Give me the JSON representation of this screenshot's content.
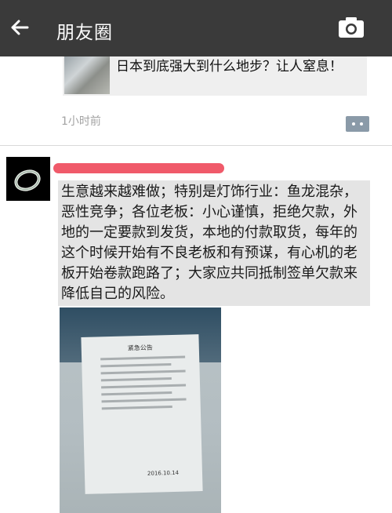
{
  "header": {
    "title": "朋友圈",
    "back_icon": "arrow-left-icon",
    "camera_icon": "camera-icon",
    "background": "#3a3a3a"
  },
  "previous_post": {
    "share_title": "日本到底强大到什么地步？让人窒息！",
    "time": "1小时前",
    "comment_icon": "comment-bubble-icon"
  },
  "post": {
    "author": "",
    "content": "生意越来越难做；特别是灯饰行业：鱼龙混杂，恶性竞争；各位老板：小心谨慎，拒绝欠款，外地的一定要款到发货，本地的付款取货，每年的这个时候开始有不良老板和有预谋，有心机的老板开始卷款跑路了；大家应共同抵制签单欠款来降低自己的风险。",
    "link_color": "#576b95",
    "redact_color": "#f05a6a",
    "photo": {
      "notice_title": "紧急公告",
      "notice_date": "2016.10.14"
    }
  }
}
